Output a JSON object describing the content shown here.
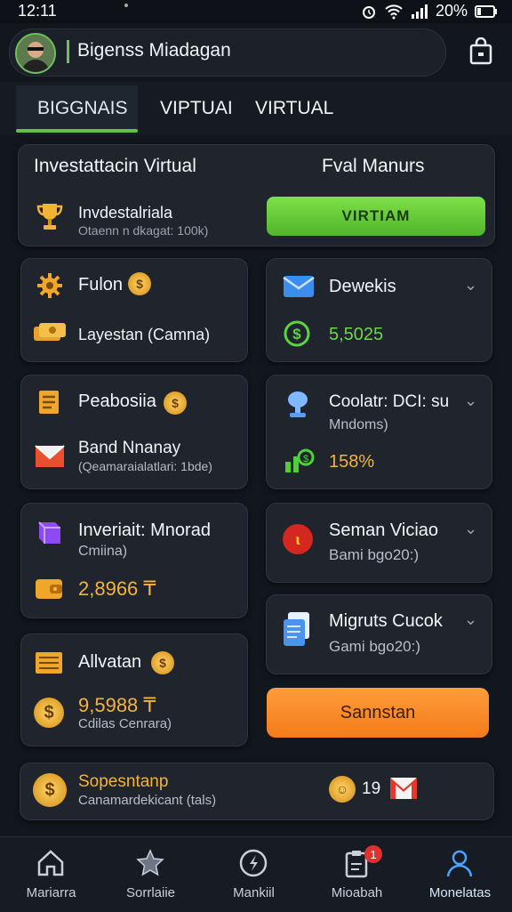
{
  "status": {
    "time": "12:11",
    "battery": "20%"
  },
  "header": {
    "title": "Bigenss Miadagan"
  },
  "tabs": [
    {
      "label": "BIGGNAIS"
    },
    {
      "label": "VIPTUAI"
    },
    {
      "label": "VIRTUAL"
    }
  ],
  "invest": {
    "title": "Investattacin Virtual",
    "right_title": "Fval Manurs",
    "row_label": "Invdestalriala",
    "row_sub": "Otaenn n dkagat: 100k)",
    "button": "VIRTIAM"
  },
  "left_cards": [
    {
      "title": "Fulon",
      "row_label": "Layestan (Camna)"
    },
    {
      "title": "Peabosiia",
      "row_label": "Band Nnanay",
      "row_sub": "(Qeamaraialatlari: 1bde)"
    },
    {
      "title": "Inveriait: Mnorad",
      "row_sub": "Cmiina)",
      "value": "2,8966 ₸"
    },
    {
      "title": "Allvatan",
      "value": "9,5988 ₸",
      "value_sub": "Cdilas Cenrara)"
    }
  ],
  "right_cards": [
    {
      "title": "Dewekis",
      "value": "5,5025"
    },
    {
      "title": "Coolatr: DCI: su",
      "sub": "Mndoms)",
      "value": "158%"
    },
    {
      "title": "Seman Viciao",
      "sub": "Bami bgo20:)"
    },
    {
      "title": "Migruts Cucok",
      "sub": "Gami bgo20:)"
    }
  ],
  "orange_button": "Sannstan",
  "footer_card": {
    "title": "Sopesntanp",
    "sub": "Canamardekicant (tals)",
    "count": "19"
  },
  "bottom_nav": [
    {
      "label": "Mariarra"
    },
    {
      "label": "Sorrlaiie"
    },
    {
      "label": "Mankiil"
    },
    {
      "label": "Mioabah",
      "badge": "1"
    },
    {
      "label": "Monelatas"
    }
  ],
  "colors": {
    "accent_green": "#5ec442",
    "accent_orange": "#f47b19",
    "gold": "#f4b43a",
    "background": "#12161d"
  }
}
